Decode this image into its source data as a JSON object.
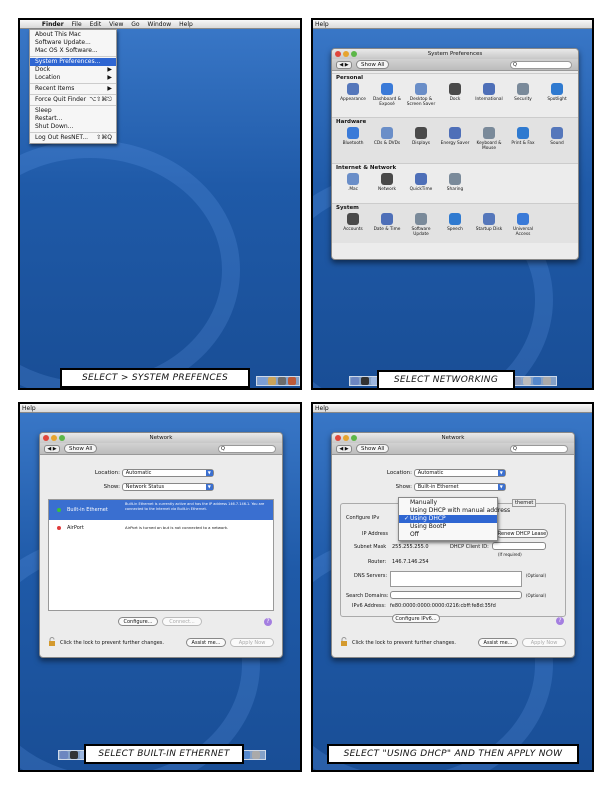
{
  "panel1": {
    "menubar": [
      "Finder",
      "File",
      "Edit",
      "View",
      "Go",
      "Window",
      "Help"
    ],
    "menu": [
      {
        "label": "About This Mac"
      },
      {
        "label": "Software Update..."
      },
      {
        "label": "Mac OS X Software..."
      },
      {
        "sep": true
      },
      {
        "label": "System Preferences...",
        "selected": true
      },
      {
        "label": "Dock",
        "arrow": "▶"
      },
      {
        "label": "Location",
        "arrow": "▶"
      },
      {
        "sep": true
      },
      {
        "label": "Recent Items",
        "arrow": "▶"
      },
      {
        "sep": true
      },
      {
        "label": "Force Quit Finder",
        "shortcut": "⌥⇧⌘⎋"
      },
      {
        "sep": true
      },
      {
        "label": "Sleep"
      },
      {
        "label": "Restart..."
      },
      {
        "label": "Shut Down..."
      },
      {
        "sep": true
      },
      {
        "label": "Log Out ResNET...",
        "shortcut": "⇧⌘Q"
      }
    ],
    "caption": "SELECT  > SYSTEM PREFENCES"
  },
  "panel2": {
    "menubar": "Help",
    "window_title": "System Preferences",
    "show_all": "Show All",
    "search_placeholder": "Q",
    "sections": [
      {
        "title": "Personal",
        "items": [
          "Appearance",
          "Dashboard & Exposé",
          "Desktop & Screen Saver",
          "Dock",
          "International",
          "Security",
          "Spotlight"
        ]
      },
      {
        "title": "Hardware",
        "items": [
          "Bluetooth",
          "CDs & DVDs",
          "Displays",
          "Energy Saver",
          "Keyboard & Mouse",
          "Print & Fax",
          "Sound"
        ]
      },
      {
        "title": "Internet & Network",
        "items": [
          ".Mac",
          "Network",
          "QuickTime",
          "Sharing"
        ]
      },
      {
        "title": "System",
        "items": [
          "Accounts",
          "Date & Time",
          "Software Update",
          "Speech",
          "Startup Disk",
          "Universal Access"
        ]
      }
    ],
    "caption": "SELECT NETWORKING"
  },
  "panel3": {
    "menubar": "Help",
    "window_title": "Network",
    "show_all": "Show All",
    "location_label": "Location:",
    "location_value": "Automatic",
    "show_label": "Show:",
    "show_value": "Network Status",
    "ports": [
      {
        "name": "Built-in Ethernet",
        "status": "Built-in Ethernet is currently active and has the IP address 146.7.146.1. You are connected to the Internet via Built-in Ethernet.",
        "selected": true
      },
      {
        "name": "AirPort",
        "status": "AirPort is turned on but is not connected to a network.",
        "selected": false
      }
    ],
    "configure_button": "Configure...",
    "connect_button": "Connect...",
    "lock_text": "Click the lock to prevent further changes.",
    "assist_button": "Assist me...",
    "apply_button": "Apply Now",
    "caption": "SELECT BUILT-IN ETHERNET"
  },
  "panel4": {
    "menubar": "Help",
    "window_title": "Network",
    "show_all": "Show All",
    "location_label": "Location:",
    "location_value": "Automatic",
    "show_label": "Show:",
    "show_value": "Built-in Ethernet",
    "tab_left": "TC",
    "tab_right": "thernet",
    "dropdown": [
      {
        "label": "Manually",
        "checked": false
      },
      {
        "label": "Using DHCP with manual address",
        "checked": false
      },
      {
        "label": "Using DHCP",
        "checked": true
      },
      {
        "label": "Using BootP",
        "checked": false
      },
      {
        "label": "Off",
        "checked": false
      }
    ],
    "configure_label": "Configure IPv",
    "ip_label": "IP Address",
    "renew_button": "Renew DHCP Lease",
    "subnet_label": "Subnet Mask",
    "subnet_value": "255.255.255.0",
    "dhcp_client_label": "DHCP Client ID:",
    "if_required": "(If required)",
    "router_label": "Router:",
    "router_value": "146.7.146.254",
    "dns_label": "DNS Servers:",
    "search_label": "Search Domains:",
    "optional": "(Optional)",
    "ipv6_label": "IPv6 Address:",
    "ipv6_value": "fe80:0000:0000:0000:0216:cbff:fe8d:35fd",
    "configure_ipv6": "Configure IPv6...",
    "lock_text": "Click the lock to prevent further changes.",
    "assist_button": "Assist me...",
    "apply_button": "Apply Now",
    "caption": "SELECT \"USING DHCP\" AND THEN APPLY NOW"
  }
}
